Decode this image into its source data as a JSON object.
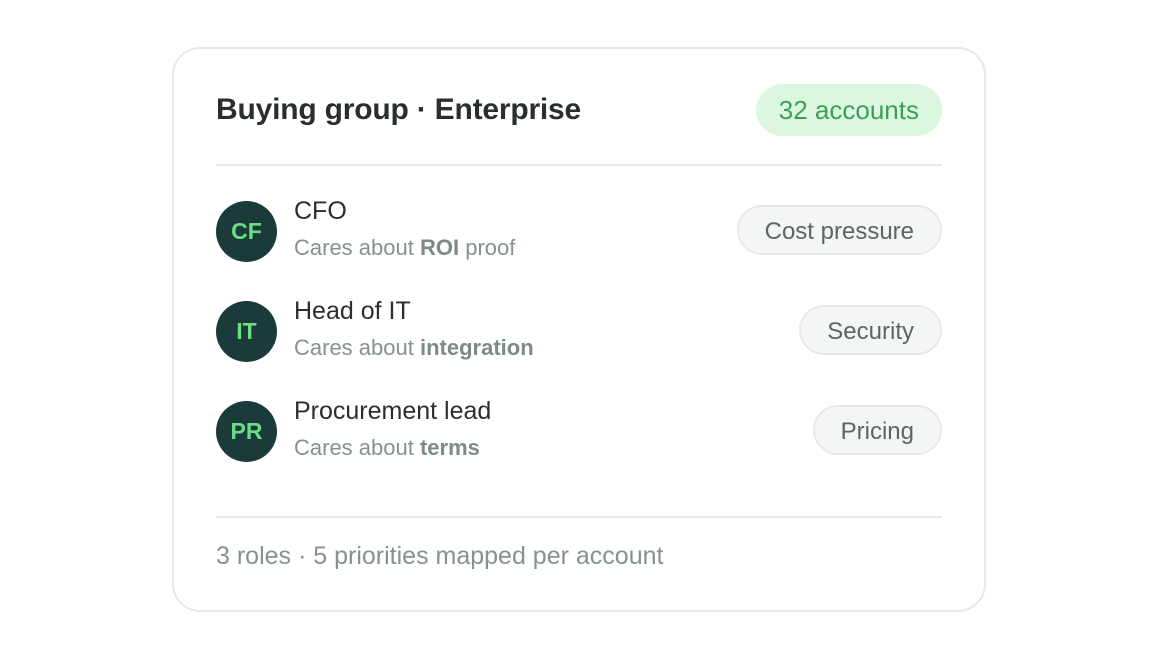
{
  "card": {
    "title": "Buying group · Enterprise",
    "accounts_badge": "32 accounts",
    "roles": [
      {
        "initials": "CF",
        "name": "CFO",
        "cares_prefix": "Cares about ",
        "cares_focus": "ROI",
        "cares_suffix": " proof",
        "tag": "Cost pressure"
      },
      {
        "initials": "IT",
        "name": "Head of IT",
        "cares_prefix": "Cares about ",
        "cares_focus": "integration",
        "cares_suffix": "",
        "tag": "Security"
      },
      {
        "initials": "PR",
        "name": "Procurement lead",
        "cares_prefix": "Cares about ",
        "cares_focus": "terms",
        "cares_suffix": "",
        "tag": "Pricing"
      }
    ],
    "footer": "3 roles · 5 priorities mapped per account"
  },
  "colors": {
    "avatar_bg": "#1b3b3a",
    "avatar_text": "#6bdd86",
    "badge_bg": "#dcf7e0",
    "badge_text": "#3f9d5c"
  }
}
